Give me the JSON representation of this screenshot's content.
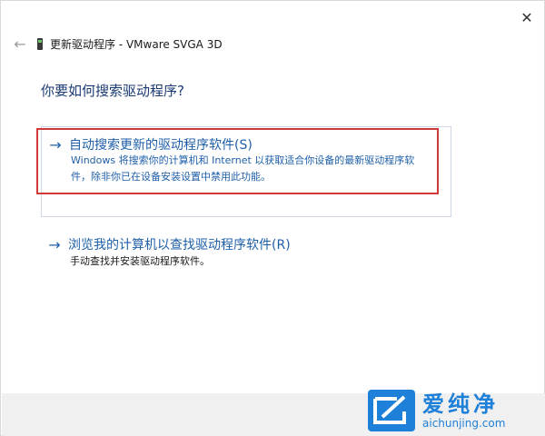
{
  "window": {
    "close_glyph": "✕",
    "back_glyph": "←",
    "title": "更新驱动程序 - VMware SVGA 3D",
    "device_icon": "display-adapter-icon"
  },
  "main": {
    "question": "你要如何搜索驱动程序?",
    "option_auto": {
      "arrow": "→",
      "label": "自动搜索更新的驱动程序软件(S)",
      "description": "Windows 将搜索你的计算机和 Internet 以获取适合你设备的最新驱动程序软\n件，除非你已在设备安装设置中禁用此功能。"
    },
    "option_browse": {
      "arrow": "→",
      "label": "浏览我的计算机以查找驱动程序软件(R)",
      "description": "手动查找并安装驱动程序软件。"
    }
  },
  "watermark": {
    "brand_cn": "爱纯净",
    "brand_url": "aichunjing.com"
  },
  "colors": {
    "link": "#1f5fa8",
    "highlight_border": "#d23a3a",
    "watermark": "#1e80d8",
    "footer": "#f0f0f0"
  }
}
